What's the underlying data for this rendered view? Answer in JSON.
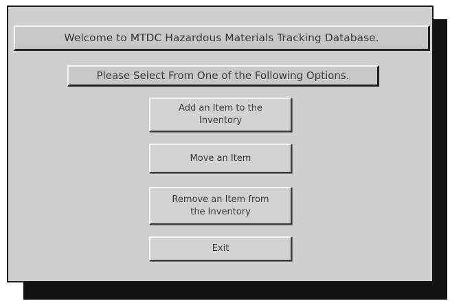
{
  "header": {
    "welcome": "Welcome to MTDC Hazardous Materials Tracking Database.",
    "instructions": "Please Select From One of the Following Options."
  },
  "menu": {
    "add_item": "Add an Item to the\nInventory",
    "move_item": "Move an Item",
    "remove_item": "Remove an Item from\nthe Inventory",
    "exit": "Exit"
  },
  "colors": {
    "window_background": "#cfcfcf",
    "drop_shadow": "#101010",
    "text": "#3a3a3a"
  }
}
